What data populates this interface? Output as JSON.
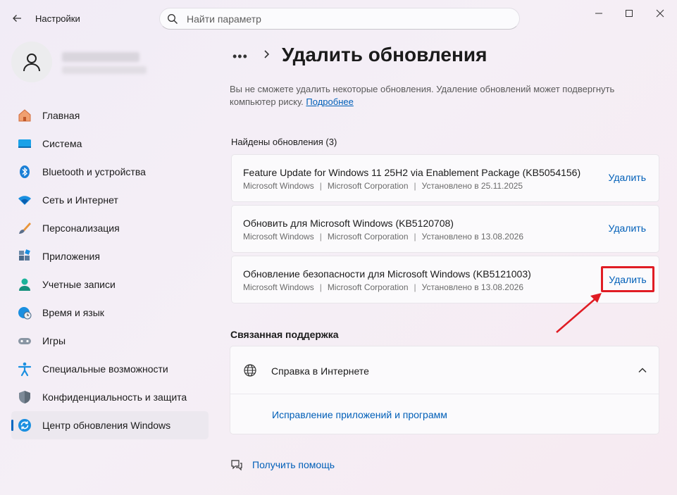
{
  "window": {
    "title": "Настройки",
    "search_placeholder": "Найти параметр"
  },
  "sidebar": {
    "items": [
      {
        "label": "Главная",
        "icon": "home-icon"
      },
      {
        "label": "Система",
        "icon": "system-icon"
      },
      {
        "label": "Bluetooth и устройства",
        "icon": "bluetooth-icon"
      },
      {
        "label": "Сеть и Интернет",
        "icon": "wifi-icon"
      },
      {
        "label": "Персонализация",
        "icon": "brush-icon"
      },
      {
        "label": "Приложения",
        "icon": "apps-icon"
      },
      {
        "label": "Учетные записи",
        "icon": "account-icon"
      },
      {
        "label": "Время и язык",
        "icon": "time-language-icon"
      },
      {
        "label": "Игры",
        "icon": "gamepad-icon"
      },
      {
        "label": "Специальные возможности",
        "icon": "accessibility-icon"
      },
      {
        "label": "Конфиденциальность и защита",
        "icon": "shield-icon"
      },
      {
        "label": "Центр обновления Windows",
        "icon": "windows-update-icon",
        "active": true
      }
    ]
  },
  "main": {
    "breadcrumb_more": "•••",
    "title": "Удалить обновления",
    "intro": "Вы не сможете удалить некоторые обновления. Удаление обновлений может подвергнуть компьютер риску.",
    "intro_link": "Подробнее",
    "found_heading": "Найдены обновления (3)",
    "updates": [
      {
        "title": "Feature Update for Windows 11 25H2 via Enablement Package (KB5054156)",
        "product": "Microsoft Windows",
        "publisher": "Microsoft Corporation",
        "installed": "Установлено в 25.11.2025",
        "action": "Удалить"
      },
      {
        "title": "Обновить для Microsoft Windows (KB5120708)",
        "product": "Microsoft Windows",
        "publisher": "Microsoft Corporation",
        "installed": "Установлено в 13.08.2026",
        "action": "Удалить"
      },
      {
        "title": "Обновление безопасности для Microsoft Windows (KB5121003)",
        "product": "Microsoft Windows",
        "publisher": "Microsoft Corporation",
        "installed": "Установлено в 13.08.2026",
        "action": "Удалить",
        "highlighted": true
      }
    ],
    "support_heading": "Связанная поддержка",
    "support_label": "Справка в Интернете",
    "support_link": "Исправление приложений и программ",
    "help_label": "Получить помощь"
  },
  "colors": {
    "accent": "#005fb8",
    "highlight_red": "#e01c24"
  }
}
